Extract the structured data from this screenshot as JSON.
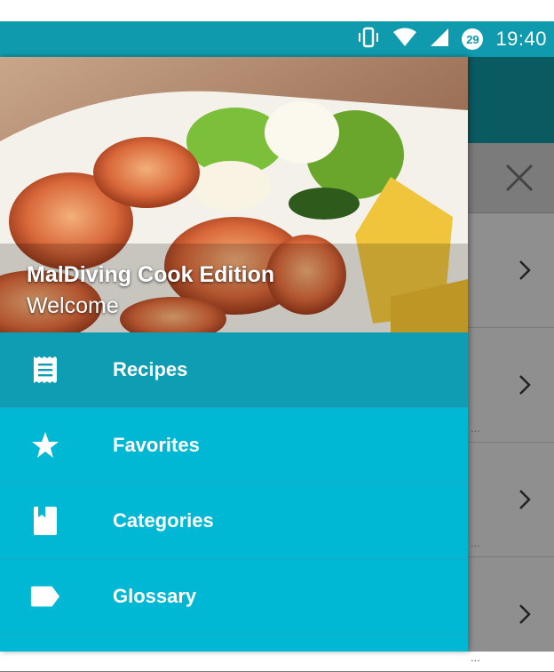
{
  "status_bar": {
    "time": "19:40",
    "notification_badge": "29",
    "icons": [
      "vibrate-icon",
      "wifi-icon",
      "cell-signal-icon",
      "notification-count-icon"
    ]
  },
  "drawer": {
    "header": {
      "title": "MalDiving Cook Edition",
      "subtitle": "Welcome"
    },
    "items": [
      {
        "label": "Recipes",
        "icon": "receipt-icon",
        "active": true
      },
      {
        "label": "Favorites",
        "icon": "star-icon",
        "active": false
      },
      {
        "label": "Categories",
        "icon": "bookmark-book-icon",
        "active": false
      },
      {
        "label": "Glossary",
        "icon": "label-tag-icon",
        "active": false
      }
    ]
  },
  "background_screen": {
    "row_count": 4,
    "row_truncation": "..."
  },
  "colors": {
    "status_bar": "#0f9aad",
    "drawer": "#00b8d4",
    "drawer_active": "#0e9db2",
    "scrim": "#8f8f8f",
    "toolbar_dim": "#0a5a62"
  }
}
